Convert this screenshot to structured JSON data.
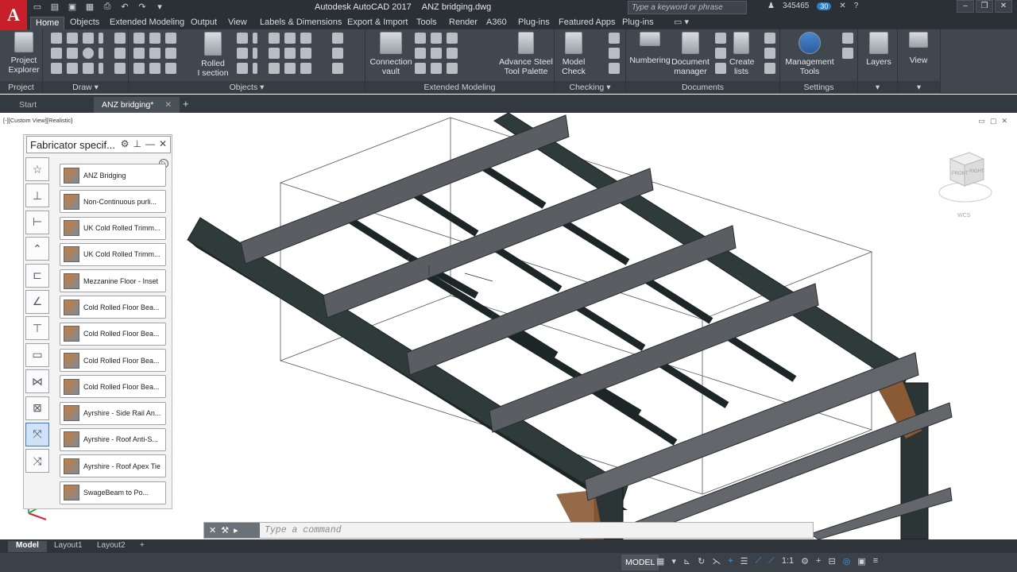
{
  "app": {
    "logo_letter": "A",
    "title": "Autodesk AutoCAD 2017",
    "file": "ANZ bridging.dwg",
    "search_placeholder": "Type a keyword or phrase",
    "user": "345465",
    "notif_count": "30"
  },
  "ribbon_tabs": [
    "Home",
    "Objects",
    "Extended Modeling",
    "Output",
    "View",
    "Labels & Dimensions",
    "Export & Import",
    "Tools",
    "Render",
    "A360",
    "Plug-ins",
    "Featured Apps",
    "Plug-ins"
  ],
  "ribbon": {
    "project_label_1": "Project",
    "project_label_2": "Explorer",
    "rolled_1": "Rolled",
    "rolled_2": "I section",
    "connection_1": "Connection",
    "connection_2": "vault",
    "advance_1": "Advance Steel",
    "advance_2": "Tool Palette",
    "model_1": "Model",
    "model_2": "Check",
    "numbering": "Numbering",
    "docmgr_1": "Document",
    "docmgr_2": "manager",
    "create_1": "Create",
    "create_2": "lists",
    "mgmt_1": "Management",
    "mgmt_2": "Tools",
    "layers": "Layers",
    "view": "View",
    "panels": {
      "project": "Project",
      "draw": "Draw",
      "objects": "Objects",
      "extended": "Extended Modeling",
      "checking": "Checking",
      "documents": "Documents",
      "settings": "Settings"
    }
  },
  "doc_tabs": {
    "start": "Start",
    "active": "ANZ bridging*"
  },
  "viewport": {
    "label": "[-][Custom View][Realistic]",
    "wcs": "WCS",
    "cube_front": "FRONT",
    "cube_right": "RIGHT"
  },
  "palette": {
    "title": "Fabricator specif...",
    "items": [
      "ANZ Bridging",
      "Non-Continuous purli...",
      "UK Cold Rolled Trimm...",
      "UK Cold Rolled Trimm...",
      "Mezzanine Floor - Inset",
      "Cold Rolled Floor Bea...",
      "Cold Rolled Floor Bea...",
      "Cold Rolled Floor Bea...",
      "Cold Rolled Floor Bea...",
      "Ayrshire - Side Rail An...",
      "Ayrshire - Roof Anti-S...",
      "Ayrshire - Roof Apex Tie",
      "SwageBeam to Po..."
    ]
  },
  "command": {
    "placeholder": "Type a command"
  },
  "layout_tabs": [
    "Model",
    "Layout1",
    "Layout2"
  ],
  "status": {
    "model": "MODEL",
    "scale": "1:1"
  },
  "colors": {
    "accent": "#c8202a",
    "ribbon": "#41474f",
    "steel_dark": "#2f3a3a",
    "steel_purlin": "#5a5e62",
    "brace_brown": "#8a5a34"
  }
}
